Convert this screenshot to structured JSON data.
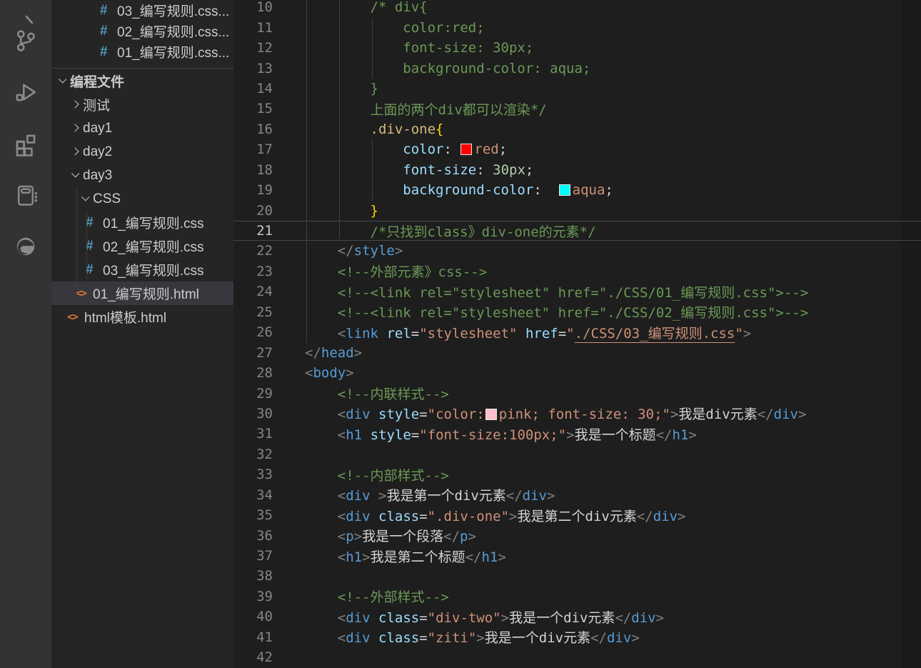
{
  "theme": {
    "activity_bar_bg": "#333333",
    "sidebar_bg": "#252526",
    "editor_bg": "#1e1e1e",
    "selection_bg": "#37373d",
    "comment": "#6a9955",
    "tag": "#569cd6",
    "attribute": "#9cdcfe",
    "string": "#ce9178",
    "number": "#b5cea8",
    "punctuation": "#808080",
    "selector": "#d7ba7d",
    "bracket": "#ffd700",
    "line_number": "#858585",
    "line_number_active": "#c6c6c6",
    "css_icon_color": "#519aba",
    "html_icon_color": "#e37933"
  },
  "activity_bar": {
    "icons": [
      {
        "name": "search-icon-partial"
      },
      {
        "name": "source-control-icon"
      },
      {
        "name": "run-and-debug-icon"
      },
      {
        "name": "extensions-icon"
      },
      {
        "name": "notebook-icon"
      },
      {
        "name": "edge-browser-icon"
      }
    ]
  },
  "sidebar": {
    "icon_glyphs": {
      "css": "#",
      "html": "<>"
    },
    "open_files": [
      {
        "label": "03_编写规则.css...",
        "icon": "css"
      },
      {
        "label": "02_编写规则.css...",
        "icon": "css"
      },
      {
        "label": "01_编写规则.css...",
        "icon": "css"
      }
    ],
    "tree": [
      {
        "label": "编程文件",
        "kind": "root",
        "chevron": "d",
        "pad": 6
      },
      {
        "label": "测试",
        "kind": "folder",
        "chevron": "r",
        "pad": 24
      },
      {
        "label": "day1",
        "kind": "folder",
        "chevron": "r",
        "pad": 24
      },
      {
        "label": "day2",
        "kind": "folder",
        "chevron": "r",
        "pad": 24
      },
      {
        "label": "day3",
        "kind": "folder",
        "chevron": "d",
        "pad": 24
      },
      {
        "label": "CSS",
        "kind": "folder",
        "chevron": "d",
        "pad": 38
      },
      {
        "label": "01_编写规则.css",
        "kind": "file",
        "icon": "css",
        "pad": 48
      },
      {
        "label": "02_编写规则.css",
        "kind": "file",
        "icon": "css",
        "pad": 48
      },
      {
        "label": "03_编写规则.css",
        "kind": "file",
        "icon": "css",
        "pad": 48
      },
      {
        "label": "01_编写规则.html",
        "kind": "file",
        "icon": "html",
        "pad": 34,
        "selected": true
      },
      {
        "label": "html模板.html",
        "kind": "file",
        "icon": "html",
        "pad": 22
      }
    ]
  },
  "editor": {
    "current_line": 21,
    "swatches": {
      "red": "#ff0000",
      "aqua": "#00ffff",
      "pink": "#ffc0cb"
    },
    "lines": [
      {
        "num": 10,
        "tokens": [
          [
            "c",
            "        /* div{"
          ]
        ]
      },
      {
        "num": 11,
        "tokens": [
          [
            "c",
            "            color:red;"
          ]
        ]
      },
      {
        "num": 12,
        "tokens": [
          [
            "c",
            "            font-size: 30px;"
          ]
        ]
      },
      {
        "num": 13,
        "tokens": [
          [
            "c",
            "            background-color: aqua;"
          ]
        ]
      },
      {
        "num": 14,
        "tokens": [
          [
            "c",
            "        }"
          ]
        ]
      },
      {
        "num": 15,
        "tokens": [
          [
            "c",
            "        上面的两个div都可以渲染*/"
          ]
        ]
      },
      {
        "num": 16,
        "tokens": [
          [
            "w",
            "        "
          ],
          [
            "sel",
            ".div-one"
          ],
          [
            "br",
            "{"
          ]
        ]
      },
      {
        "num": 17,
        "tokens": [
          [
            "w",
            "            "
          ],
          [
            "a",
            "color"
          ],
          [
            "w",
            ": "
          ],
          [
            "sw",
            "#ff0000"
          ],
          [
            "s",
            "red"
          ],
          [
            "w",
            ";"
          ]
        ]
      },
      {
        "num": 18,
        "tokens": [
          [
            "w",
            "            "
          ],
          [
            "a",
            "font-size"
          ],
          [
            "w",
            ": "
          ],
          [
            "n",
            "30px"
          ],
          [
            "w",
            ";"
          ]
        ]
      },
      {
        "num": 19,
        "tokens": [
          [
            "w",
            "            "
          ],
          [
            "a",
            "background-color"
          ],
          [
            "w",
            ":  "
          ],
          [
            "sw",
            "#00ffff"
          ],
          [
            "s",
            "aqua"
          ],
          [
            "w",
            ";"
          ]
        ]
      },
      {
        "num": 20,
        "tokens": [
          [
            "w",
            "        "
          ],
          [
            "br",
            "}"
          ]
        ]
      },
      {
        "num": 21,
        "tokens": [
          [
            "c",
            "        /*只找到class》div-one的元素*/"
          ]
        ]
      },
      {
        "num": 22,
        "tokens": [
          [
            "w",
            "    "
          ],
          [
            "p",
            "</"
          ],
          [
            "t",
            "style"
          ],
          [
            "p",
            ">"
          ]
        ]
      },
      {
        "num": 23,
        "tokens": [
          [
            "w",
            "    "
          ],
          [
            "c",
            "<!--外部元素》css-->"
          ]
        ]
      },
      {
        "num": 24,
        "tokens": [
          [
            "w",
            "    "
          ],
          [
            "c",
            "<!--<link rel=\"stylesheet\" href=\"./CSS/01_编写规则.css\">-->"
          ]
        ]
      },
      {
        "num": 25,
        "tokens": [
          [
            "w",
            "    "
          ],
          [
            "c",
            "<!--<link rel=\"stylesheet\" href=\"./CSS/02_编写规则.css\">-->"
          ]
        ]
      },
      {
        "num": 26,
        "tokens": [
          [
            "w",
            "    "
          ],
          [
            "p",
            "<"
          ],
          [
            "t",
            "link"
          ],
          [
            "w",
            " "
          ],
          [
            "a",
            "rel"
          ],
          [
            "w",
            "="
          ],
          [
            "s",
            "\"stylesheet\""
          ],
          [
            "w",
            " "
          ],
          [
            "a",
            "href"
          ],
          [
            "w",
            "="
          ],
          [
            "s",
            "\""
          ],
          [
            "u",
            "./CSS/03_编写规则.css"
          ],
          [
            "s",
            "\""
          ],
          [
            "p",
            ">"
          ]
        ]
      },
      {
        "num": 27,
        "tokens": [
          [
            "p",
            "</"
          ],
          [
            "t",
            "head"
          ],
          [
            "p",
            ">"
          ]
        ]
      },
      {
        "num": 28,
        "tokens": [
          [
            "p",
            "<"
          ],
          [
            "t",
            "body"
          ],
          [
            "p",
            ">"
          ]
        ]
      },
      {
        "num": 29,
        "tokens": [
          [
            "w",
            "    "
          ],
          [
            "c",
            "<!--内联样式-->"
          ]
        ]
      },
      {
        "num": 30,
        "tokens": [
          [
            "w",
            "    "
          ],
          [
            "p",
            "<"
          ],
          [
            "t",
            "div"
          ],
          [
            "w",
            " "
          ],
          [
            "a",
            "style"
          ],
          [
            "w",
            "="
          ],
          [
            "s",
            "\"color:"
          ],
          [
            "sw",
            "#ffc0cb"
          ],
          [
            "s",
            "pink; font-size: 30;\""
          ],
          [
            "p",
            ">"
          ],
          [
            "w",
            "我是div元素"
          ],
          [
            "p",
            "</"
          ],
          [
            "t",
            "div"
          ],
          [
            "p",
            ">"
          ]
        ]
      },
      {
        "num": 31,
        "tokens": [
          [
            "w",
            "    "
          ],
          [
            "p",
            "<"
          ],
          [
            "t",
            "h1"
          ],
          [
            "w",
            " "
          ],
          [
            "a",
            "style"
          ],
          [
            "w",
            "="
          ],
          [
            "s",
            "\"font-size:100px;\""
          ],
          [
            "p",
            ">"
          ],
          [
            "w",
            "我是一个标题"
          ],
          [
            "p",
            "</"
          ],
          [
            "t",
            "h1"
          ],
          [
            "p",
            ">"
          ]
        ]
      },
      {
        "num": 32,
        "tokens": []
      },
      {
        "num": 33,
        "tokens": [
          [
            "w",
            "    "
          ],
          [
            "c",
            "<!--内部样式-->"
          ]
        ]
      },
      {
        "num": 34,
        "tokens": [
          [
            "w",
            "    "
          ],
          [
            "p",
            "<"
          ],
          [
            "t",
            "div"
          ],
          [
            "w",
            " "
          ],
          [
            "p",
            ">"
          ],
          [
            "w",
            "我是第一个div元素"
          ],
          [
            "p",
            "</"
          ],
          [
            "t",
            "div"
          ],
          [
            "p",
            ">"
          ]
        ]
      },
      {
        "num": 35,
        "tokens": [
          [
            "w",
            "    "
          ],
          [
            "p",
            "<"
          ],
          [
            "t",
            "div"
          ],
          [
            "w",
            " "
          ],
          [
            "a",
            "class"
          ],
          [
            "w",
            "="
          ],
          [
            "s",
            "\".div-one\""
          ],
          [
            "p",
            ">"
          ],
          [
            "w",
            "我是第二个div元素"
          ],
          [
            "p",
            "</"
          ],
          [
            "t",
            "div"
          ],
          [
            "p",
            ">"
          ]
        ]
      },
      {
        "num": 36,
        "tokens": [
          [
            "w",
            "    "
          ],
          [
            "p",
            "<"
          ],
          [
            "t",
            "p"
          ],
          [
            "p",
            ">"
          ],
          [
            "w",
            "我是一个段落"
          ],
          [
            "p",
            "</"
          ],
          [
            "t",
            "p"
          ],
          [
            "p",
            ">"
          ]
        ]
      },
      {
        "num": 37,
        "tokens": [
          [
            "w",
            "    "
          ],
          [
            "p",
            "<"
          ],
          [
            "t",
            "h1"
          ],
          [
            "p",
            ">"
          ],
          [
            "w",
            "我是第二个标题"
          ],
          [
            "p",
            "</"
          ],
          [
            "t",
            "h1"
          ],
          [
            "p",
            ">"
          ]
        ]
      },
      {
        "num": 38,
        "tokens": []
      },
      {
        "num": 39,
        "tokens": [
          [
            "w",
            "    "
          ],
          [
            "c",
            "<!--外部样式-->"
          ]
        ]
      },
      {
        "num": 40,
        "tokens": [
          [
            "w",
            "    "
          ],
          [
            "p",
            "<"
          ],
          [
            "t",
            "div"
          ],
          [
            "w",
            " "
          ],
          [
            "a",
            "class"
          ],
          [
            "w",
            "="
          ],
          [
            "s",
            "\"div-two\""
          ],
          [
            "p",
            ">"
          ],
          [
            "w",
            "我是一个div元素"
          ],
          [
            "p",
            "</"
          ],
          [
            "t",
            "div"
          ],
          [
            "p",
            ">"
          ]
        ]
      },
      {
        "num": 41,
        "tokens": [
          [
            "w",
            "    "
          ],
          [
            "p",
            "<"
          ],
          [
            "t",
            "div"
          ],
          [
            "w",
            " "
          ],
          [
            "a",
            "class"
          ],
          [
            "w",
            "="
          ],
          [
            "s",
            "\"ziti\""
          ],
          [
            "p",
            ">"
          ],
          [
            "w",
            "我是一个div元素"
          ],
          [
            "p",
            "</"
          ],
          [
            "t",
            "div"
          ],
          [
            "p",
            ">"
          ]
        ]
      },
      {
        "num": 42,
        "tokens": []
      }
    ]
  }
}
